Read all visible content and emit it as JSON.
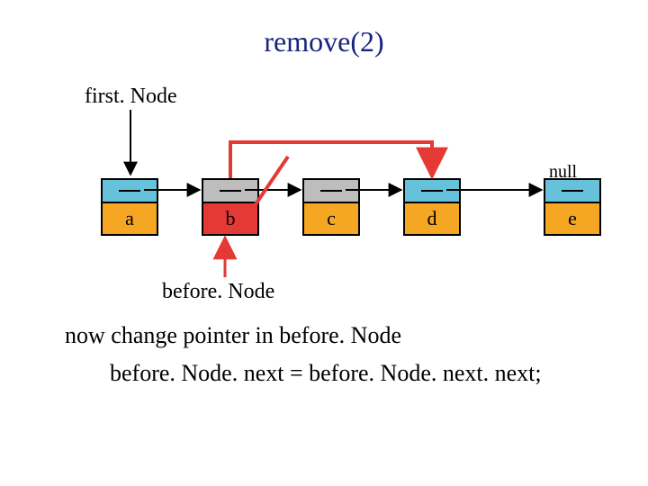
{
  "title": "remove(2)",
  "labels": {
    "first_node": "first. Node",
    "before_node": "before. Node",
    "null": "null"
  },
  "nodes": {
    "a": "a",
    "b": "b",
    "c": "c",
    "d": "d",
    "e": "e"
  },
  "captions": {
    "line1": "now change pointer in before. Node",
    "line2": "before. Node. next = before. Node. next. next;"
  },
  "chart_data": {
    "type": "diagram",
    "structure": "singly-linked-list",
    "operation": "remove at index 2",
    "nodes": [
      "a",
      "b",
      "c",
      "d",
      "e"
    ],
    "first_node_points_to": "a",
    "before_node_points_to": "b",
    "removed_node": "c",
    "original_next_links": {
      "a": "b",
      "b": "c",
      "c": "d",
      "d": "e",
      "e": "null"
    },
    "new_link": {
      "from": "b",
      "to": "d"
    },
    "crossed_out_link": {
      "from": "b",
      "to": "c"
    }
  }
}
